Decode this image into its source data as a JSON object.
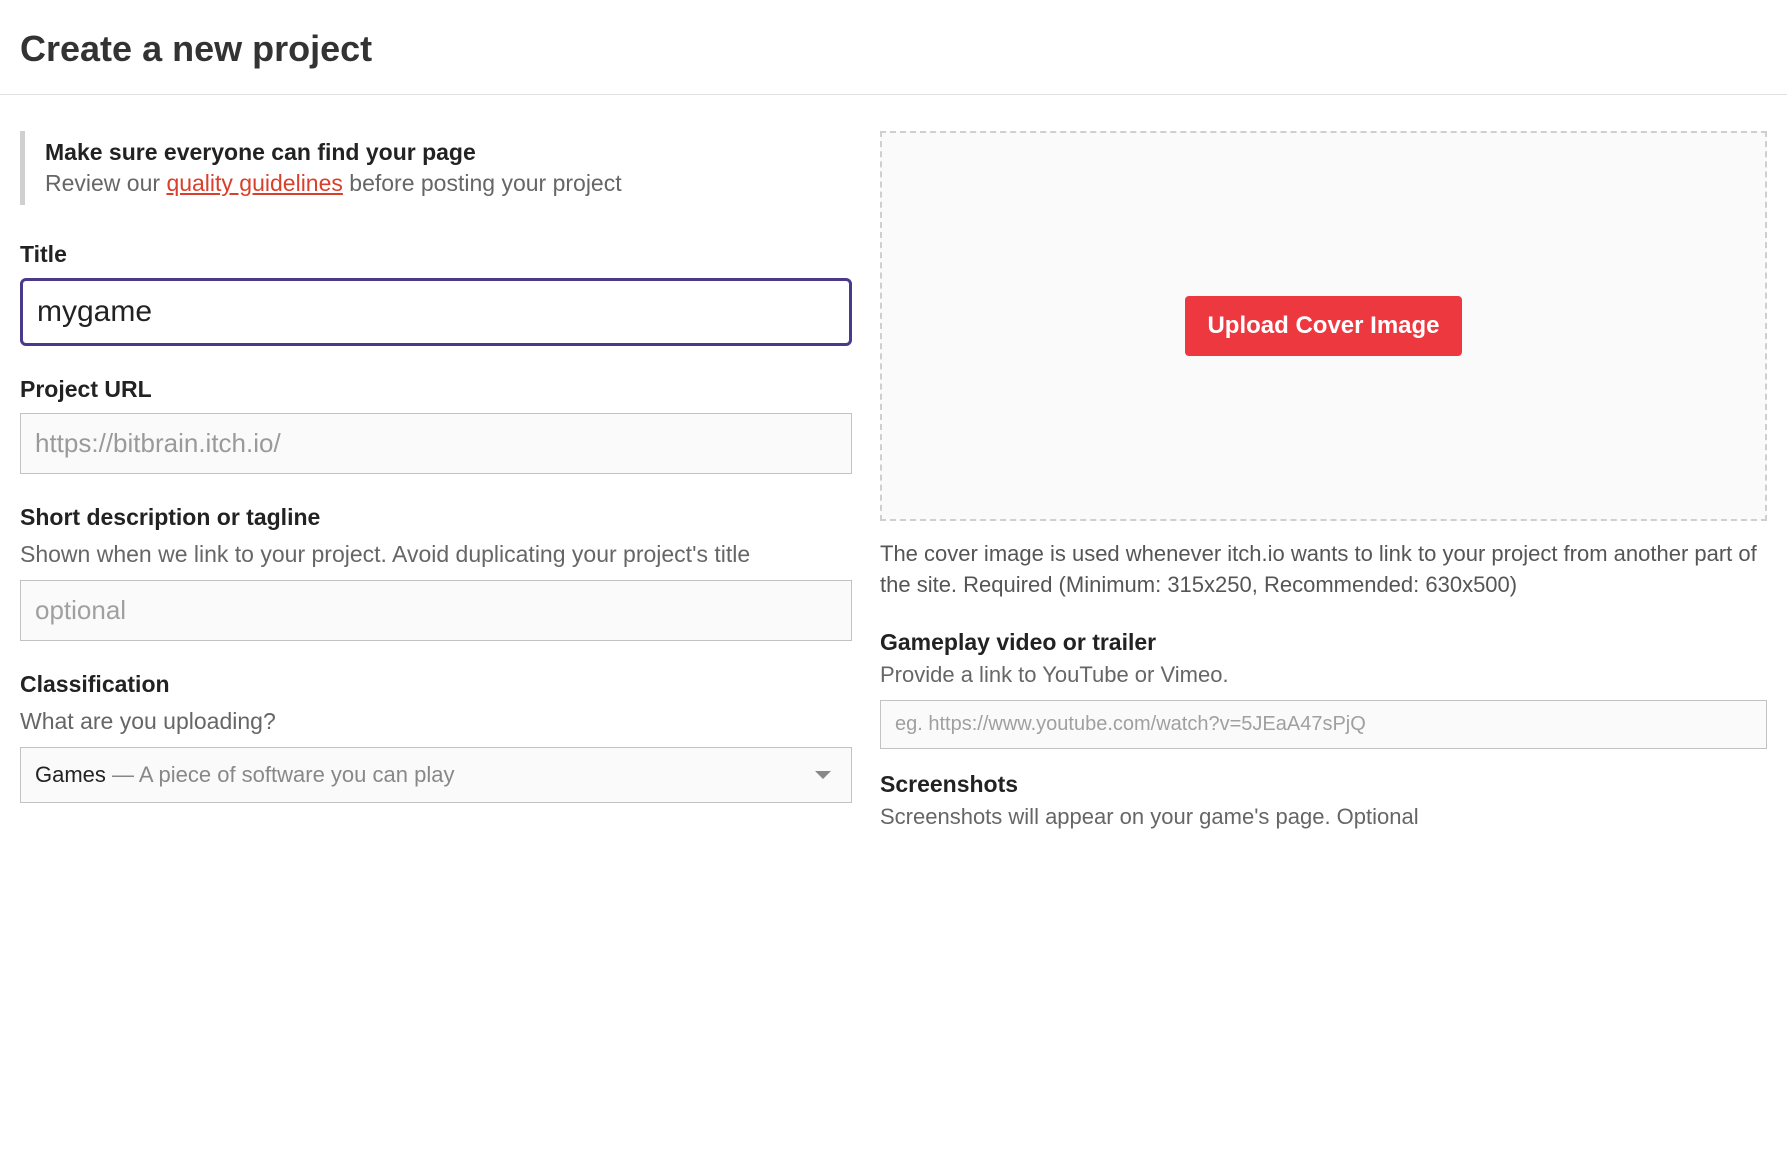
{
  "header": {
    "title": "Create a new project"
  },
  "notice": {
    "title": "Make sure everyone can find your page",
    "before_link": "Review our ",
    "link_text": "quality guidelines",
    "after_link": " before posting your project"
  },
  "form": {
    "title": {
      "label": "Title",
      "value": "mygame"
    },
    "project_url": {
      "label": "Project URL",
      "value": "https://bitbrain.itch.io/"
    },
    "short_desc": {
      "label": "Short description or tagline",
      "hint": "Shown when we link to your project. Avoid duplicating your project's title",
      "placeholder": "optional"
    },
    "classification": {
      "label": "Classification",
      "hint": "What are you uploading?",
      "selected": "Games",
      "secondary": " — A piece of software you can play"
    }
  },
  "aside": {
    "cover": {
      "button": "Upload Cover Image",
      "help": "The cover image is used whenever itch.io wants to link to your project from another part of the site. Required (Minimum: 315x250, Recommended: 630x500)"
    },
    "video": {
      "label": "Gameplay video or trailer",
      "hint": "Provide a link to YouTube or Vimeo.",
      "placeholder": "eg. https://www.youtube.com/watch?v=5JEaA47sPjQ"
    },
    "screenshots": {
      "label": "Screenshots",
      "hint": "Screenshots will appear on your game's page. Optional"
    }
  }
}
